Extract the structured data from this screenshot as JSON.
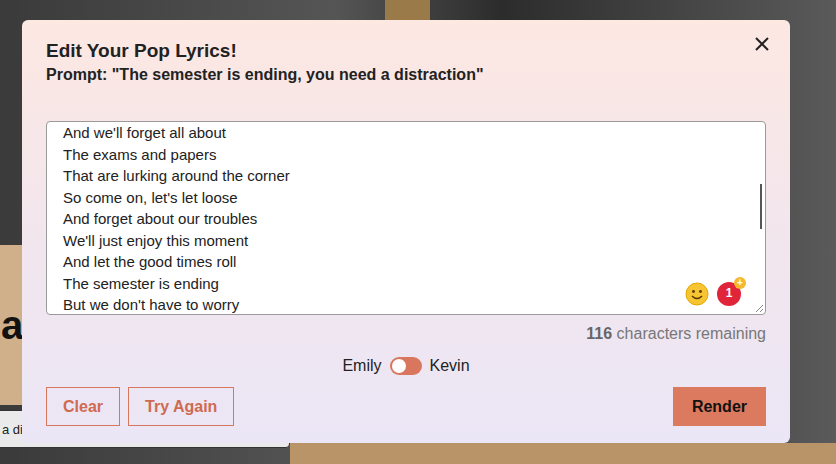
{
  "background": {
    "headline_fragment": "a",
    "field_text": "a di"
  },
  "dialog": {
    "title": "Edit Your Pop Lyrics!",
    "prompt": "Prompt: \"The semester is ending, you need a distraction\""
  },
  "lyrics": [
    "And we'll forget all about",
    "The exams and papers",
    "That are lurking around the corner",
    "So come on, let's let loose",
    "And forget about our troubles",
    "We'll just enjoy this moment",
    "And let the good times roll",
    "The semester is ending",
    "But we don't have to worry"
  ],
  "badge": {
    "count": "1",
    "plus": "+"
  },
  "counter": {
    "number": "116",
    "label": "characters remaining"
  },
  "voices": [
    {
      "label": "Emily",
      "selected": true
    },
    {
      "label": "Kevin",
      "selected": false
    }
  ],
  "buttons": [
    {
      "label": "Clear",
      "kind": "outline"
    },
    {
      "label": "Try Again",
      "kind": "outline"
    },
    {
      "label": "Render",
      "kind": "primary"
    }
  ]
}
